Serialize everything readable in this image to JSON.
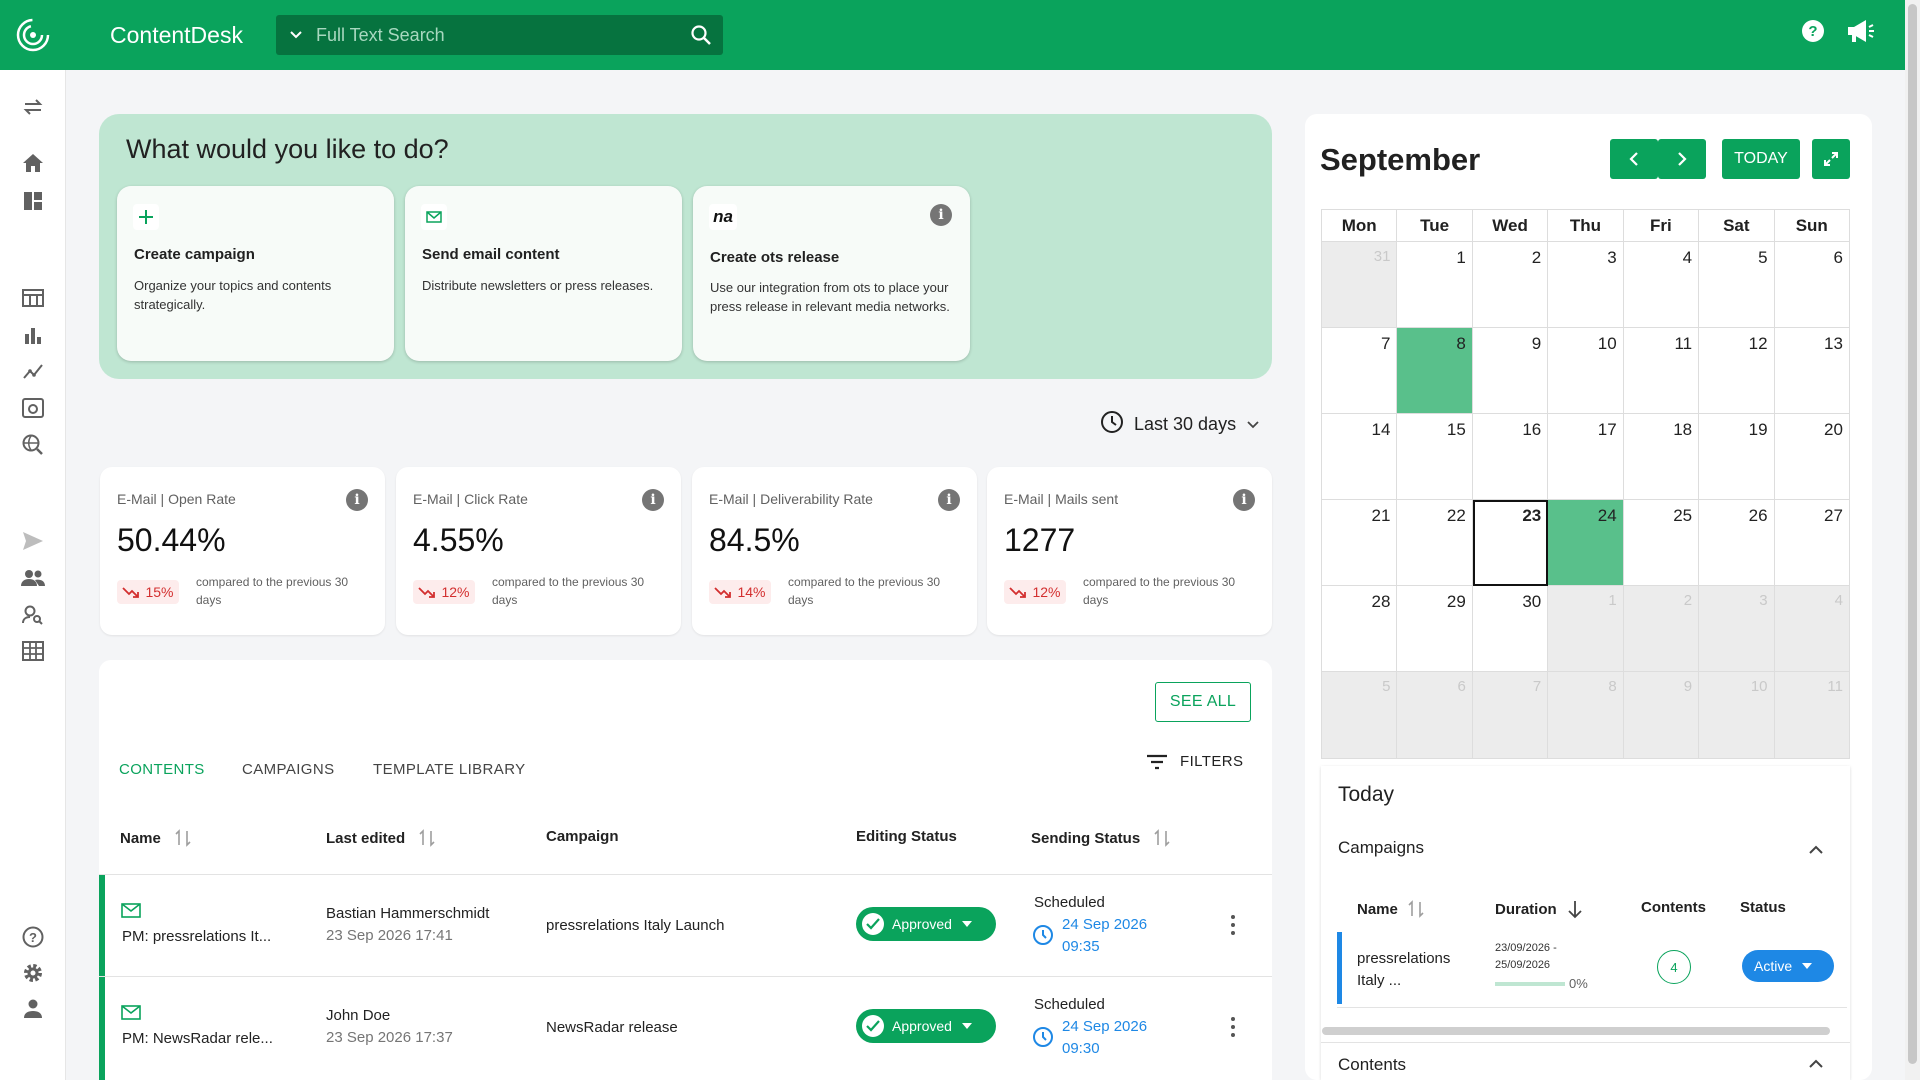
{
  "app": {
    "name": "ContentDesk"
  },
  "search": {
    "placeholder": "Full Text Search"
  },
  "hero": {
    "title": "What would you like to do?",
    "cards": [
      {
        "title": "Create campaign",
        "desc": "Organize your topics and contents strategically."
      },
      {
        "title": "Send email content",
        "desc": "Distribute newsletters or press releases."
      },
      {
        "title": "Create ots release",
        "desc": "Use our integration from ots to place your press release in relevant media networks.",
        "logo": "na"
      }
    ]
  },
  "range": {
    "label": "Last 30 days"
  },
  "stats": [
    {
      "label": "E-Mail | Open Rate",
      "value": "50.44%",
      "change": "15%",
      "compare": "compared to the previous 30 days"
    },
    {
      "label": "E-Mail | Click Rate",
      "value": "4.55%",
      "change": "12%",
      "compare": "compared to the previous 30 days"
    },
    {
      "label": "E-Mail | Deliverability Rate",
      "value": "84.5%",
      "change": "14%",
      "compare": "compared to the previous 30 days"
    },
    {
      "label": "E-Mail | Mails sent",
      "value": "1277",
      "change": "12%",
      "compare": "compared to the previous 30 days"
    }
  ],
  "panel": {
    "see_all": "SEE ALL",
    "tabs": [
      "CONTENTS",
      "CAMPAIGNS",
      "TEMPLATE LIBRARY"
    ],
    "filters": "FILTERS",
    "columns": [
      "Name",
      "Last edited",
      "Campaign",
      "Editing Status",
      "Sending Status"
    ],
    "rows": [
      {
        "name": "PM: pressrelations It...",
        "editor": "Bastian Hammerschmidt",
        "edited": "23 Sep 2026 17:41",
        "campaign": "pressrelations Italy Launch",
        "status": "Approved",
        "sending": "Scheduled",
        "date": "24 Sep 2026",
        "time": "09:35"
      },
      {
        "name": "PM: NewsRadar rele...",
        "editor": "John Doe",
        "edited": "23 Sep 2026 17:37",
        "campaign": "NewsRadar release",
        "status": "Approved",
        "sending": "Scheduled",
        "date": "24 Sep 2026",
        "time": "09:30"
      }
    ]
  },
  "calendar": {
    "month": "September",
    "today_label": "TODAY",
    "weekdays": [
      "Mon",
      "Tue",
      "Wed",
      "Thu",
      "Fri",
      "Sat",
      "Sun"
    ],
    "weeks": [
      [
        "31",
        "1",
        "2",
        "3",
        "4",
        "5",
        "6"
      ],
      [
        "7",
        "8",
        "9",
        "10",
        "11",
        "12",
        "13"
      ],
      [
        "14",
        "15",
        "16",
        "17",
        "18",
        "19",
        "20"
      ],
      [
        "21",
        "22",
        "23",
        "24",
        "25",
        "26",
        "27"
      ],
      [
        "28",
        "29",
        "30",
        "1",
        "2",
        "3",
        "4"
      ],
      [
        "5",
        "6",
        "7",
        "8",
        "9",
        "10",
        "11"
      ]
    ],
    "highlighted": [
      "8",
      "24"
    ],
    "today": "23"
  },
  "today_panel": {
    "title": "Today",
    "section": "Campaigns",
    "columns": [
      "Name",
      "Duration",
      "Contents",
      "Status"
    ],
    "row": {
      "name_line1": "pressrelations",
      "name_line2": "Italy ...",
      "dur_line1": "23/09/2026 -",
      "dur_line2": "25/09/2026",
      "progress": "0%",
      "contents": "4",
      "status": "Active"
    },
    "contents_section": "Contents"
  },
  "colors": {
    "brand": "#0aa35c",
    "brand_dark": "#06733f",
    "hero_bg": "#bfe6d2",
    "calendar_highlight": "#59c08b",
    "active_blue": "#1e88e5",
    "negative": "#d32f2f"
  }
}
